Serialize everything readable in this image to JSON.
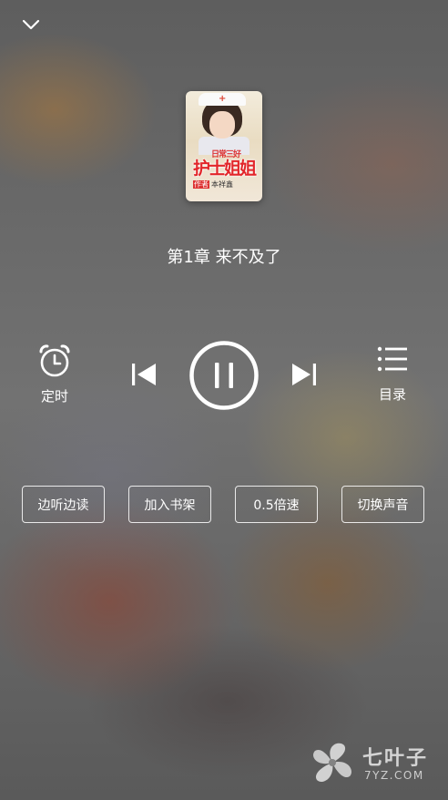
{
  "book": {
    "cover_subtitle": "日常三好",
    "cover_title": "护士姐姐",
    "cover_author_tag": "作者",
    "cover_author": "本祥鑫"
  },
  "player": {
    "chapter_title": "第1章 来不及了",
    "timer_label": "定时",
    "toc_label": "目录",
    "state": "playing"
  },
  "actions": [
    {
      "label": "边听边读"
    },
    {
      "label": "加入书架"
    },
    {
      "label": "0.5倍速"
    },
    {
      "label": "切换声音"
    }
  ],
  "watermark": {
    "name_cn": "七叶子",
    "name_en": "7YZ.COM"
  },
  "icons": {
    "collapse": "chevron-down-icon",
    "timer": "alarm-clock-icon",
    "prev": "skip-previous-icon",
    "play": "pause-icon",
    "next": "skip-next-icon",
    "toc": "list-icon"
  }
}
